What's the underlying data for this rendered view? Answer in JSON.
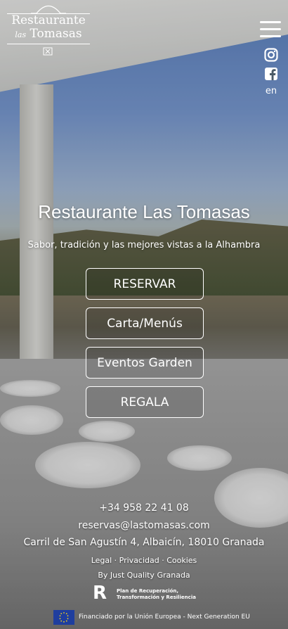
{
  "brand": {
    "logo_line1": "Restaurante",
    "logo_line2_small": "las",
    "logo_line2": "Tomasas"
  },
  "header": {
    "language": "en"
  },
  "hero": {
    "title": "Restaurante Las Tomasas",
    "subtitle": "Sabor, tradición y las mejores vistas a la Alhambra"
  },
  "buttons": [
    {
      "label": "RESERVAR"
    },
    {
      "label": "Carta/Menús"
    },
    {
      "label": "Eventos Garden"
    },
    {
      "label": "REGALA"
    }
  ],
  "footer": {
    "phone": "+34 958 22 41 08",
    "email": "reservas@lastomasas.com",
    "address": "Carril de San Agustín 4, Albaicín, 18010 Granada",
    "legal_links": "Legal · Privacidad · Cookies",
    "credit": "By Just Quality Granada",
    "plan_line1": "Plan de Recuperación,",
    "plan_line2": "Transformación y Resiliencia",
    "eu_funding": "Financiado por la Unión Europea - Next Generation EU"
  }
}
